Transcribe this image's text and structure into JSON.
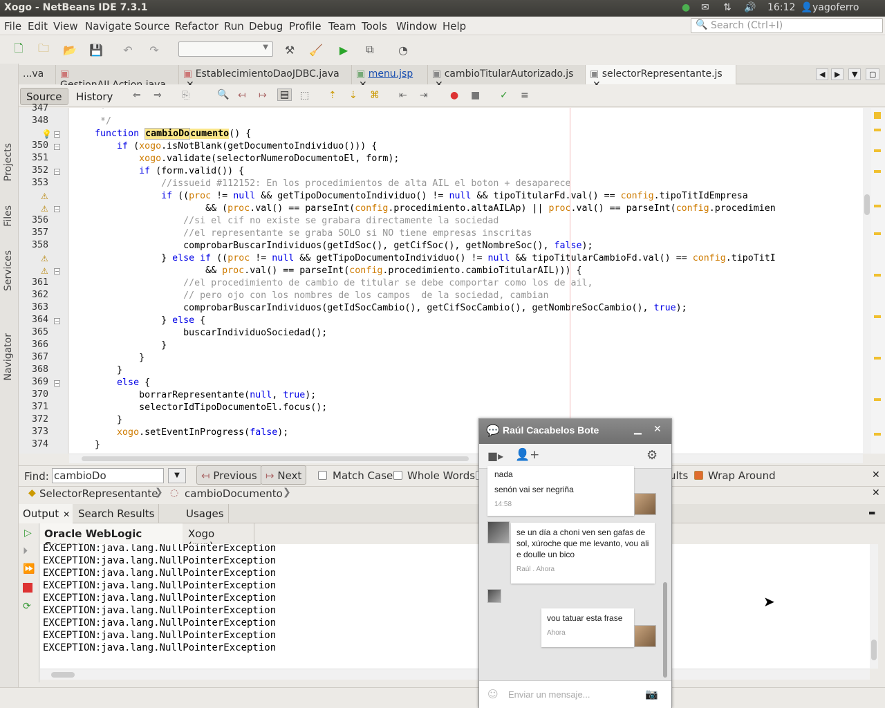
{
  "window": {
    "title": "Xogo - NetBeans IDE 7.3.1"
  },
  "tray": {
    "time": "16:12",
    "user": "yagoferro"
  },
  "menus": [
    "File",
    "Edit",
    "View",
    "Navigate",
    "Source",
    "Refactor",
    "Run",
    "Debug",
    "Profile",
    "Team",
    "Tools",
    "Window",
    "Help"
  ],
  "search": {
    "placeholder": "Search (Ctrl+I)"
  },
  "side_tabs": [
    "Projects",
    "Files",
    "Services",
    "Navigator"
  ],
  "editor_tabs": [
    {
      "label": "...va"
    },
    {
      "label": "GestionAILAction.java"
    },
    {
      "label": "EstablecimientoDaoJDBC.java"
    },
    {
      "label": "menu.jsp"
    },
    {
      "label": "cambioTitularAutorizado.js"
    },
    {
      "label": "selectorRepresentante.js"
    }
  ],
  "editor_toolbar": {
    "source": "Source",
    "history": "History"
  },
  "code": {
    "lines": [
      {
        "n": "347",
        "t": "     *"
      },
      {
        "n": "348",
        "t": "     */"
      },
      {
        "n": "",
        "t": "    function cambioDocumento() {"
      },
      {
        "n": "350",
        "t": "        if (xogo.isNotBlank(getDocumentoIndividuo())) {"
      },
      {
        "n": "351",
        "t": "            xogo.validate(selectorNumeroDocumentoEl, form);"
      },
      {
        "n": "352",
        "t": "            if (form.valid()) {"
      },
      {
        "n": "353",
        "t": "                //issueid #112152: En los procedimientos de alta AIL el boton + desaparece"
      },
      {
        "n": "",
        "t": "                if ((proc != null && getTipoDocumentoIndividuo() != null && tipoTitularFd.val() == config.tipoTitIdEmpresa"
      },
      {
        "n": "",
        "t": "                        && (proc.val() == parseInt(config.procedimiento.altaAILAp) || proc.val() == parseInt(config.procedimien"
      },
      {
        "n": "356",
        "t": "                    //si el cif no existe se grabara directamente la sociedad"
      },
      {
        "n": "357",
        "t": "                    //el representante se graba SOLO si NO tiene empresas inscritas"
      },
      {
        "n": "358",
        "t": "                    comprobarBuscarIndividuos(getIdSoc(), getCifSoc(), getNombreSoc(), false);"
      },
      {
        "n": "",
        "t": "                } else if ((proc != null && getTipoDocumentoIndividuo() != null && tipoTitularCambioFd.val() == config.tipoTitI"
      },
      {
        "n": "",
        "t": "                        && proc.val() == parseInt(config.procedimiento.cambioTitularAIL))) {"
      },
      {
        "n": "361",
        "t": "                    //el procedimiento de cambio de titular se debe comportar como los de ail,"
      },
      {
        "n": "362",
        "t": "                    // pero ojo con los nombres de los campos  de la sociedad, cambian"
      },
      {
        "n": "363",
        "t": "                    comprobarBuscarIndividuos(getIdSocCambio(), getCifSocCambio(), getNombreSocCambio(), true);"
      },
      {
        "n": "364",
        "t": "                } else {"
      },
      {
        "n": "365",
        "t": "                    buscarIndividuoSociedad();"
      },
      {
        "n": "366",
        "t": "                }"
      },
      {
        "n": "367",
        "t": "            }"
      },
      {
        "n": "368",
        "t": "        }"
      },
      {
        "n": "369",
        "t": "        else {"
      },
      {
        "n": "370",
        "t": "            borrarRepresentante(null, true);"
      },
      {
        "n": "371",
        "t": "            selectorIdTipoDocumentoEl.focus();"
      },
      {
        "n": "372",
        "t": "        }"
      },
      {
        "n": "373",
        "t": "        xogo.setEventInProgress(false);"
      },
      {
        "n": "374",
        "t": "    }"
      }
    ]
  },
  "find": {
    "label": "Find:",
    "value": "cambioDo",
    "previous": "Previous",
    "next": "Next",
    "match_case": "Match Case",
    "whole_words": "Whole Words",
    "regex_partial": "ults",
    "wrap_around": "Wrap Around"
  },
  "breadcrumb": [
    "SelectorRepresentante",
    "cambioDocumento"
  ],
  "output_tabs": [
    "Output",
    "Search Results",
    "Usages"
  ],
  "output_subtabs": [
    "Oracle WebLogic Server",
    "Xogo (run)"
  ],
  "output_lines": [
    "EXCEPTION:java.lang.NullPointerException",
    "EXCEPTION:java.lang.NullPointerException",
    "EXCEPTION:java.lang.NullPointerException",
    "EXCEPTION:java.lang.NullPointerException",
    "EXCEPTION:java.lang.NullPointerException",
    "EXCEPTION:java.lang.NullPointerException",
    "EXCEPTION:java.lang.NullPointerException",
    "EXCEPTION:java.lang.NullPointerException",
    "EXCEPTION:java.lang.NullPointerException"
  ],
  "chat": {
    "contact": "Raúl Cacabelos Bote",
    "messages": [
      {
        "text1": "nada",
        "text2": "senón vai ser negriña",
        "meta": "14:58"
      },
      {
        "text": "se un día a choni ven sen gafas de sol, xúroche que me levanto, vou ali e doulle un bico",
        "meta": "Raúl . Ahora"
      },
      {
        "text": "vou tatuar esta frase",
        "meta": "Ahora"
      }
    ],
    "input_placeholder": "Enviar un mensaje..."
  },
  "colors": {
    "keyword": "#0000e6",
    "comment": "#969696",
    "global": "#ce7b00",
    "warning": "#b8860b"
  }
}
